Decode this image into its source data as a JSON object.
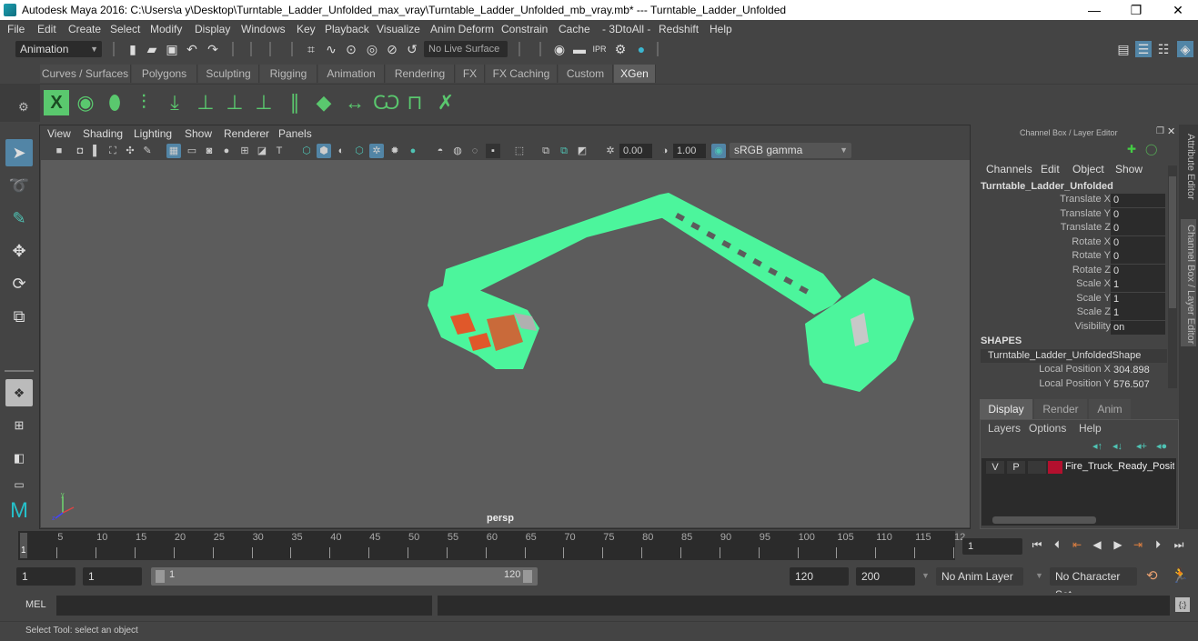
{
  "window": {
    "title": "Autodesk Maya 2016: C:\\Users\\a y\\Desktop\\Turntable_Ladder_Unfolded_max_vray\\Turntable_Ladder_Unfolded_mb_vray.mb*   ---   Turntable_Ladder_Unfolded",
    "minimize": "—",
    "restore": "❐",
    "close": "✕"
  },
  "menubar": [
    "File",
    "Edit",
    "Create",
    "Select",
    "Modify",
    "Display",
    "Windows",
    "Key",
    "Playback",
    "Visualize",
    "Anim Deform",
    "Constrain",
    "Cache",
    "- 3DtoAll -",
    "Redshift",
    "Help"
  ],
  "toolbar": {
    "menuset": "Animation",
    "live_surface": "No Live Surface"
  },
  "shelf": {
    "tabs": [
      "Curves / Surfaces",
      "Polygons",
      "Sculpting",
      "Rigging",
      "Animation",
      "Rendering",
      "FX",
      "FX Caching",
      "Custom",
      "XGen"
    ],
    "active_tab": "XGen",
    "icons": [
      "xgen-editor-icon",
      "create-description-icon",
      "toggle-preview-icon",
      "add-guides-icon",
      "place-guides-icon",
      "add-guide-icon",
      "sculpt-guide-icon",
      "lock-guide-icon",
      "guides-to-curves-icon",
      "patch-icon",
      "guide-length-icon",
      "select-guides-icon",
      "guide-frame-icon",
      "delete-guides-icon"
    ]
  },
  "viewport": {
    "menu": [
      "View",
      "Shading",
      "Lighting",
      "Show",
      "Renderer",
      "Panels"
    ],
    "exposure": "0.00",
    "gamma": "1.00",
    "color_space": "sRGB gamma",
    "camera_label": "persp",
    "model_color": "#4cf59c"
  },
  "channel_box": {
    "title": "Channel Box / Layer Editor",
    "menu": [
      "Channels",
      "Edit",
      "Object",
      "Show"
    ],
    "object_name": "Turntable_Ladder_Unfolded",
    "channels": [
      {
        "label": "Translate X",
        "value": "0"
      },
      {
        "label": "Translate Y",
        "value": "0"
      },
      {
        "label": "Translate Z",
        "value": "0"
      },
      {
        "label": "Rotate X",
        "value": "0"
      },
      {
        "label": "Rotate Y",
        "value": "0"
      },
      {
        "label": "Rotate Z",
        "value": "0"
      },
      {
        "label": "Scale X",
        "value": "1"
      },
      {
        "label": "Scale Y",
        "value": "1"
      },
      {
        "label": "Scale Z",
        "value": "1"
      },
      {
        "label": "Visibility",
        "value": "on"
      }
    ],
    "shapes_header": "SHAPES",
    "shape_name": "Turntable_Ladder_UnfoldedShape",
    "shape_channels": [
      {
        "label": "Local Position X",
        "value": "304.898"
      },
      {
        "label": "Local Position Y",
        "value": "576.507"
      }
    ]
  },
  "side_tabs": [
    "Attribute Editor",
    "Channel Box / Layer Editor"
  ],
  "layer_editor": {
    "tabs": [
      "Display",
      "Render",
      "Anim"
    ],
    "active_tab": "Display",
    "menu": [
      "Layers",
      "Options",
      "Help"
    ],
    "layers": [
      {
        "v": "V",
        "p": "P",
        "color": "#b3102e",
        "name": "Fire_Truck_Ready_Positic"
      }
    ]
  },
  "timeline": {
    "ticks": [
      "5",
      "10",
      "15",
      "20",
      "25",
      "30",
      "35",
      "40",
      "45",
      "50",
      "55",
      "60",
      "65",
      "70",
      "75",
      "80",
      "85",
      "90",
      "95",
      "100",
      "105",
      "110",
      "115",
      "12"
    ],
    "current_frame_marker": "1",
    "current_frame": "1"
  },
  "range": {
    "start": "1",
    "playback_start": "1",
    "slider_start": "1",
    "slider_end": "120",
    "playback_end": "120",
    "end": "200",
    "anim_layer": "No Anim Layer",
    "character_set": "No Character Set"
  },
  "command_line": {
    "mode": "MEL",
    "input": "",
    "output": ""
  },
  "help_line": "Select Tool: select an object"
}
